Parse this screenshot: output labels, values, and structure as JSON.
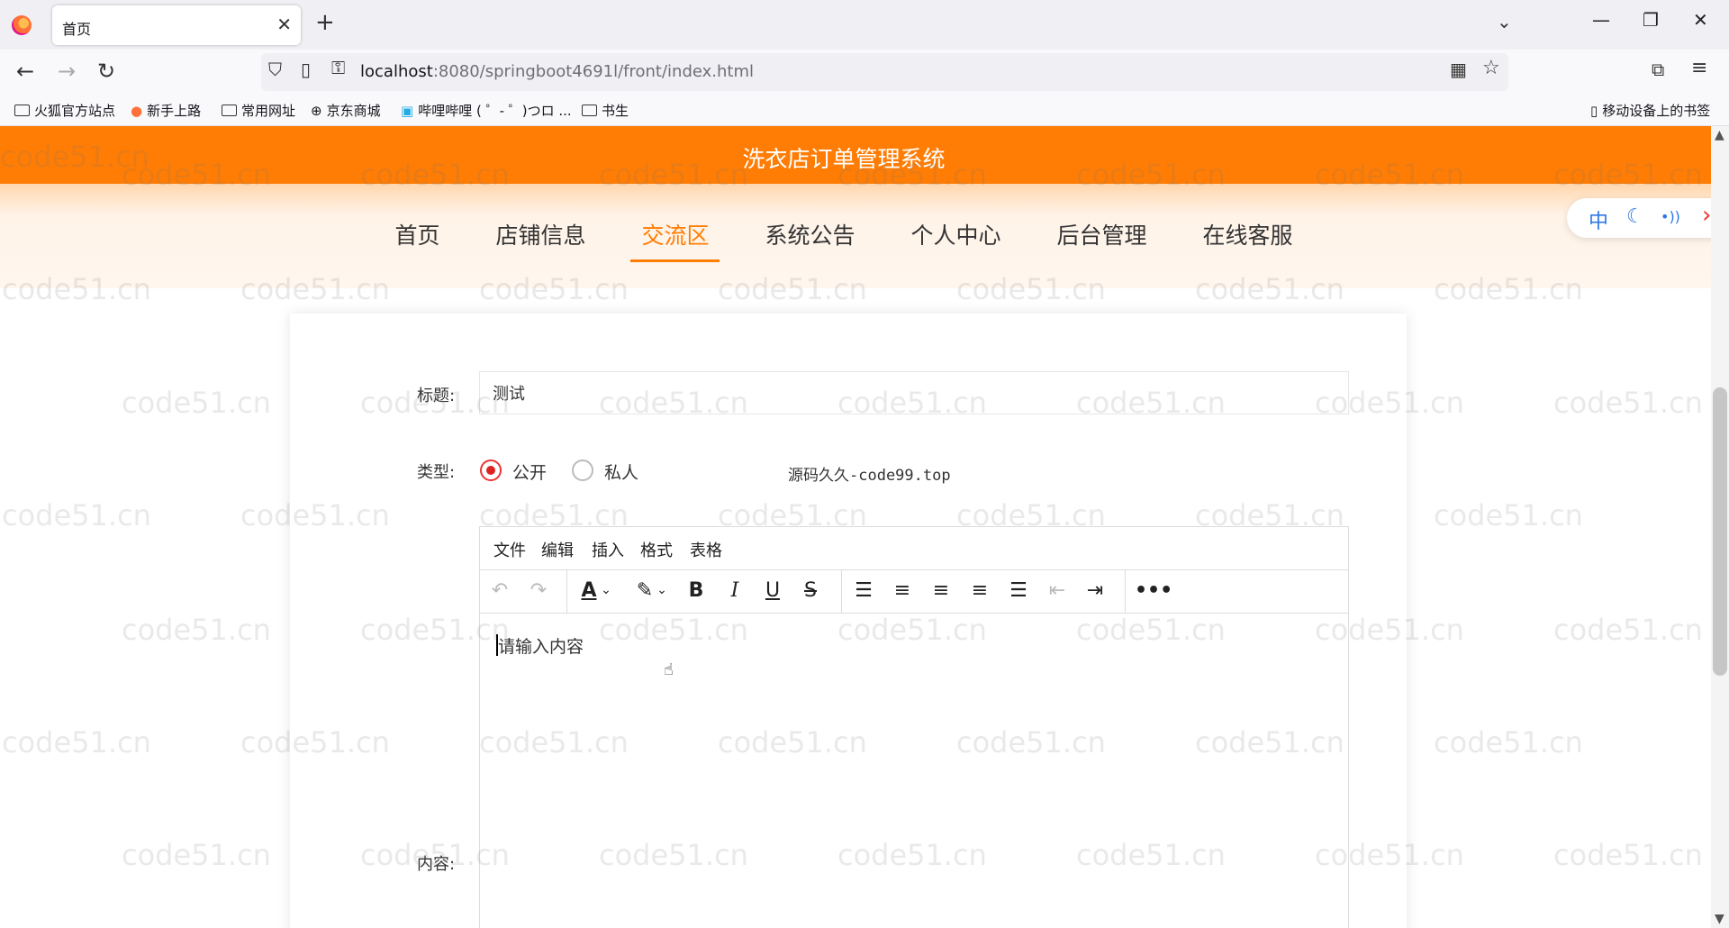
{
  "browser": {
    "tab_title": "首页",
    "url_host": "localhost",
    "url_rest": ":8080/springboot4691l/front/index.html",
    "bookmarks": [
      "火狐官方站点",
      "新手上路",
      "常用网址",
      "京东商城",
      "哔哩哔哩 ( ゜- ゜)つロ ...",
      "书生"
    ],
    "mobile_bookmarks": "移动设备上的书签"
  },
  "site": {
    "title": "洗衣店订单管理系统",
    "nav": [
      "首页",
      "店铺信息",
      "交流区",
      "系统公告",
      "个人中心",
      "后台管理",
      "在线客服"
    ],
    "active_nav": "交流区"
  },
  "float_tools": {
    "lang": "中",
    "moon": "☾",
    "dots": "•))",
    "arrow": "›"
  },
  "form": {
    "title_label": "标题:",
    "title_value": "测试",
    "type_label": "类型:",
    "type_options": [
      "公开",
      "私人"
    ],
    "type_selected": "公开",
    "note": "源码久久-code99.top",
    "content_label": "内容:"
  },
  "editor": {
    "menus": [
      "文件",
      "编辑",
      "插入",
      "格式",
      "表格"
    ],
    "placeholder": "请输入内容"
  },
  "watermark": "code51.cn"
}
